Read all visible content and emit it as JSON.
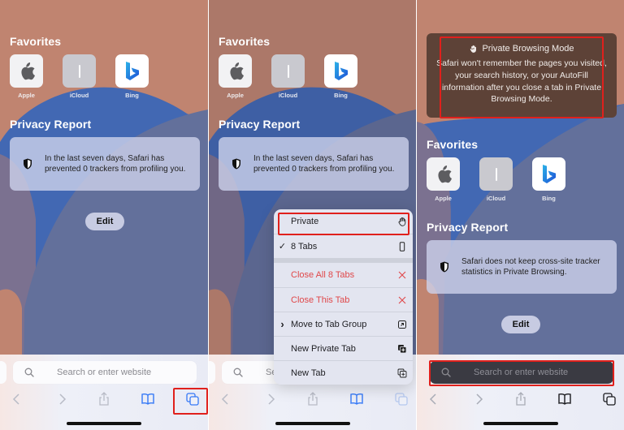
{
  "colors": {
    "accent_blue": "#3478f6",
    "highlight_red": "#e0201c",
    "destructive_red": "#e0484a",
    "wallpaper_peach": "#c08470",
    "wallpaper_blue": "#4268b3",
    "wallpaper_slate": "#63709b",
    "private_banner_bg": "#5d4237",
    "private_search_bg": "#3a3a42"
  },
  "favorites": {
    "title": "Favorites",
    "items": [
      {
        "label": "Apple",
        "icon": "apple-logo-icon"
      },
      {
        "label": "iCloud",
        "icon": "icloud-icon"
      },
      {
        "label": "Bing",
        "icon": "bing-logo-icon"
      }
    ]
  },
  "privacy_report": {
    "title": "Privacy Report",
    "normal_text": "In the last seven days, Safari has prevented 0 trackers from profiling you.",
    "private_text": "Safari does not keep cross-site tracker statistics in Private Browsing.",
    "icon": "shield-icon"
  },
  "edit_label": "Edit",
  "search": {
    "placeholder": "Search or enter website",
    "partial_placeholder": "Se"
  },
  "toolbar": {
    "icons": [
      "back-chevron-icon",
      "forward-chevron-icon",
      "share-icon",
      "bookmarks-icon",
      "tabs-icon"
    ]
  },
  "tab_menu": {
    "items": [
      {
        "label": "Private",
        "lead": "",
        "trail_icon": "hand-raised-icon",
        "danger": false,
        "highlighted": true
      },
      {
        "label": "8 Tabs",
        "lead": "✓",
        "trail_icon": "phone-icon",
        "danger": false,
        "highlighted": false
      },
      {
        "label": "Close All 8 Tabs",
        "lead": "",
        "trail_icon": "close-x-icon",
        "danger": true,
        "highlighted": false
      },
      {
        "label": "Close This Tab",
        "lead": "",
        "trail_icon": "close-x-icon",
        "danger": true,
        "highlighted": false
      },
      {
        "label": "Move to Tab Group",
        "lead": "›",
        "trail_icon": "arrow-up-right-square-icon",
        "danger": false,
        "highlighted": false
      },
      {
        "label": "New Private Tab",
        "lead": "",
        "trail_icon": "new-private-tab-icon",
        "danger": false,
        "highlighted": false
      },
      {
        "label": "New Tab",
        "lead": "",
        "trail_icon": "new-tab-icon",
        "danger": false,
        "highlighted": false
      }
    ]
  },
  "private_banner": {
    "title": "Private Browsing Mode",
    "body": "Safari won't remember the pages you visited, your search history, or your AutoFill information after you close a tab in Private Browsing Mode.",
    "icon": "hand-raised-icon"
  }
}
